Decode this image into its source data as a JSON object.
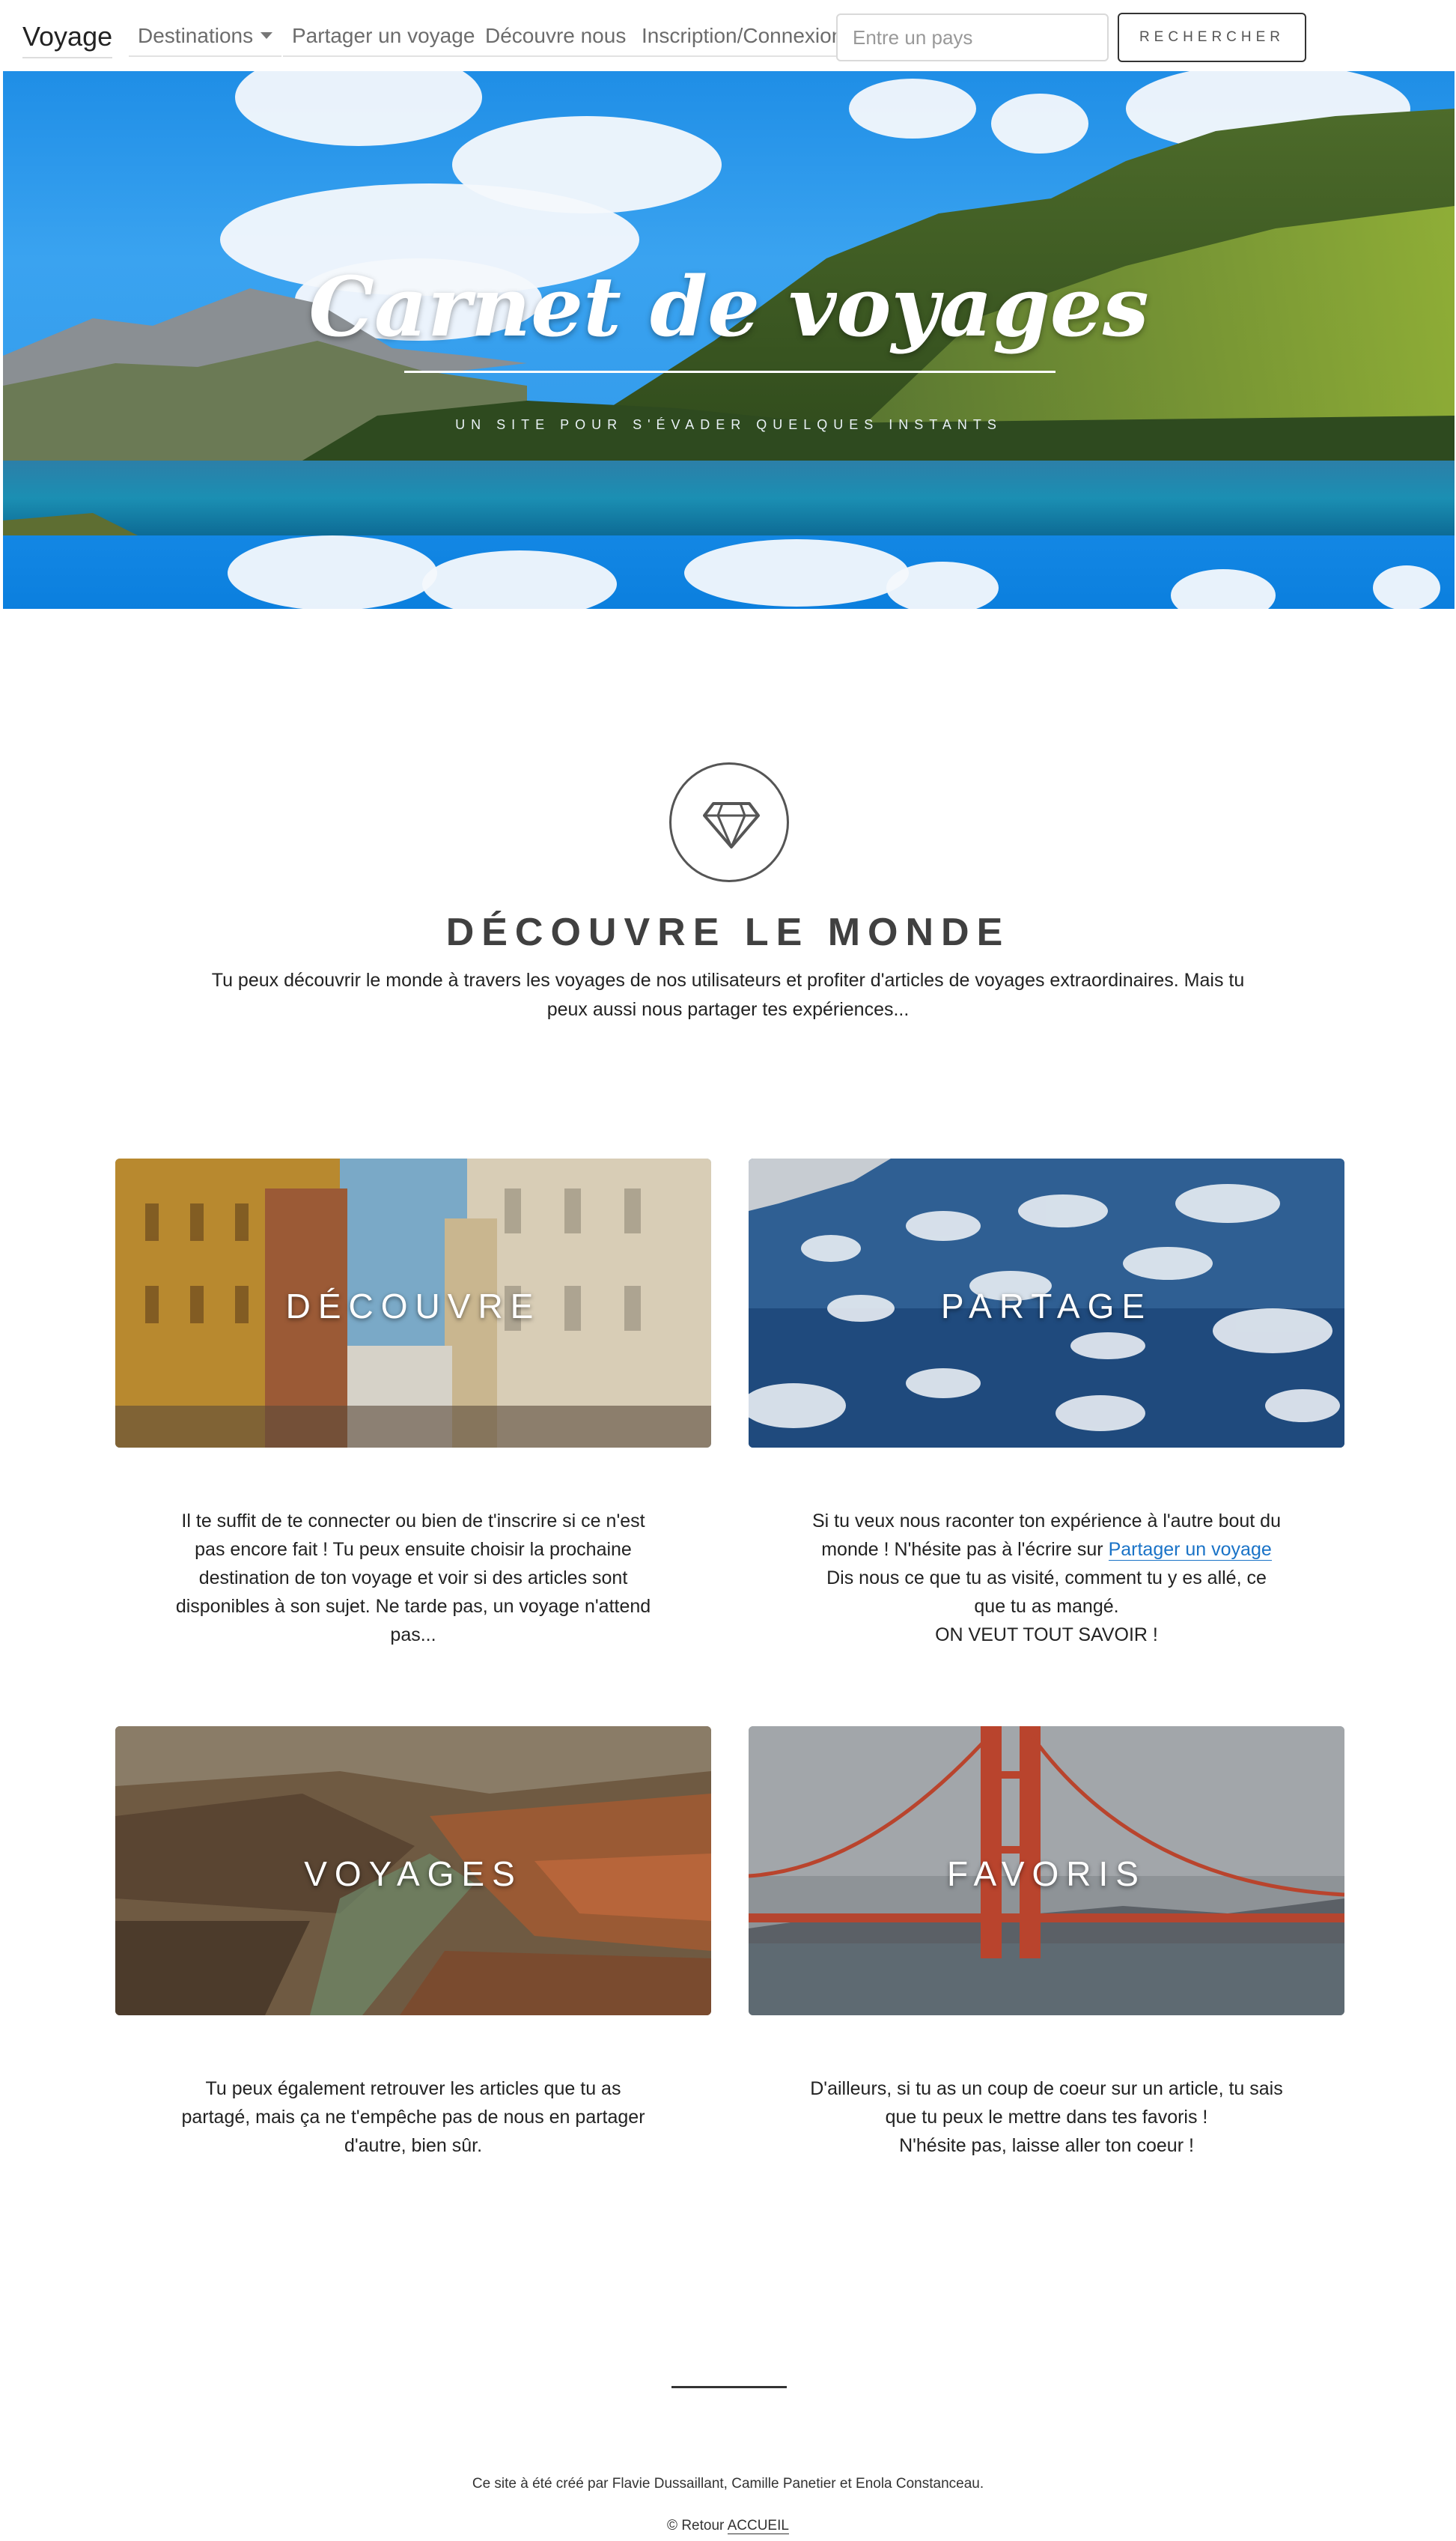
{
  "navbar": {
    "brand": "Voyage",
    "links": [
      {
        "label": "Destinations",
        "dropdown": true
      },
      {
        "label": "Partager un voyage"
      },
      {
        "label": "Découvre nous"
      },
      {
        "label": "Inscription/Connexion"
      }
    ],
    "search_placeholder": "Entre un pays",
    "search_button": "RECHERCHER"
  },
  "hero": {
    "title": "Carnet de voyages",
    "subtitle": "UN SITE POUR S'ÉVADER QUELQUES INSTANTS"
  },
  "intro": {
    "icon": "diamond-icon",
    "title": "DÉCOUVRE LE MONDE",
    "text": "Tu peux découvrir le monde à travers les voyages de nos utilisateurs et profiter d'articles de voyages extraordinaires. Mais tu peux aussi nous partager tes expériences..."
  },
  "cards": [
    {
      "label": "DÉCOUVRE",
      "text": "Il te suffit de te connecter ou bien de t'inscrire si ce n'est pas encore fait ! Tu peux ensuite choisir la prochaine destination de ton voyage et voir si des articles sont disponibles à son sujet. Ne tarde pas, un voyage n'attend pas..."
    },
    {
      "label": "PARTAGE",
      "text_before": "Si tu veux nous raconter ton expérience à l'autre bout du monde ! N'hésite pas à l'écrire sur ",
      "link": "Partager un voyage",
      "text_after": " Dis nous ce que tu as visité, comment tu y es allé, ce que tu as mangé.",
      "text_last": "ON VEUT TOUT SAVOIR !"
    },
    {
      "label": "VOYAGES",
      "text": "Tu peux également retrouver les articles que tu as partagé, mais ça ne t'empêche pas de nous en partager d'autre, bien sûr."
    },
    {
      "label": "FAVORIS",
      "text": "D'ailleurs, si tu as un coup de coeur sur un article, tu sais que tu peux le mettre dans tes favoris !",
      "text_last": "N'hésite pas, laisse aller ton coeur !"
    }
  ],
  "footer": {
    "credit": "Ce site à été créé par Flavie Dussaillant, Camille Panetier et Enola Constanceau.",
    "back_prefix": "© Retour ",
    "back_link": "ACCUEIL"
  }
}
